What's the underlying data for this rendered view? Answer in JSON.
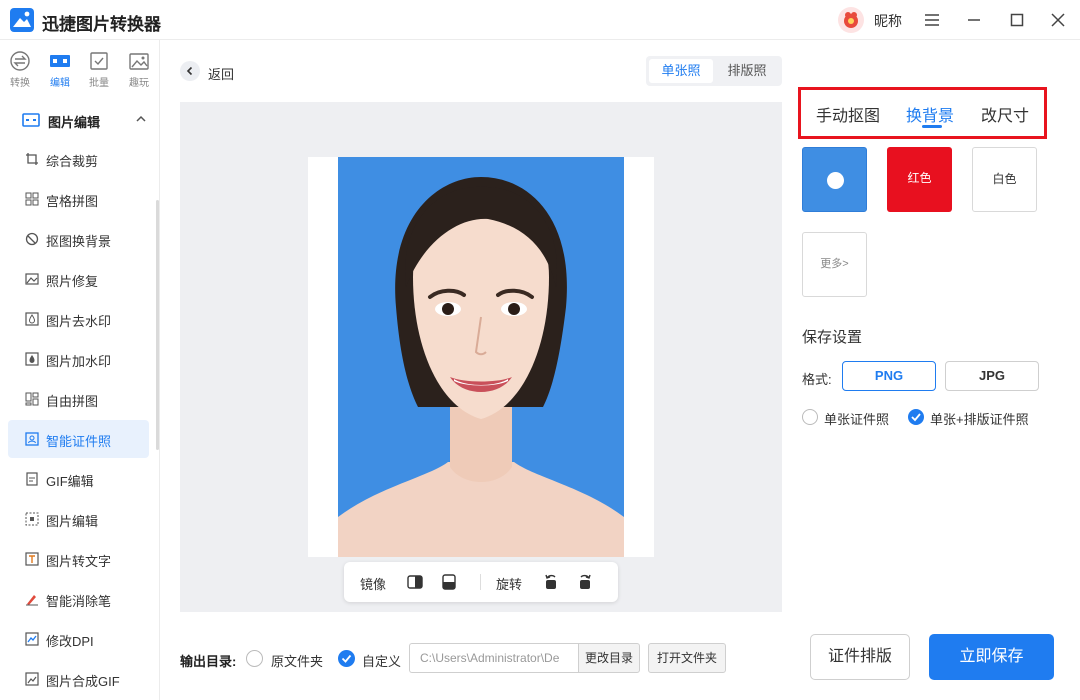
{
  "app": {
    "title": "迅捷图片转换器",
    "nickname": "昵称"
  },
  "mode_tabs": [
    {
      "label": "转换",
      "icon": "convert-icon"
    },
    {
      "label": "编辑",
      "icon": "edit-icon"
    },
    {
      "label": "批量",
      "icon": "batch-icon"
    },
    {
      "label": "趣玩",
      "icon": "fun-icon"
    }
  ],
  "sidebar": {
    "section_title": "图片编辑",
    "items": [
      {
        "label": "综合裁剪",
        "icon": "crop-icon"
      },
      {
        "label": "宫格拼图",
        "icon": "grid-icon"
      },
      {
        "label": "抠图换背景",
        "icon": "cutout-icon"
      },
      {
        "label": "照片修复",
        "icon": "repair-icon"
      },
      {
        "label": "图片去水印",
        "icon": "remove-watermark-icon"
      },
      {
        "label": "图片加水印",
        "icon": "add-watermark-icon"
      },
      {
        "label": "自由拼图",
        "icon": "collage-icon"
      },
      {
        "label": "智能证件照",
        "icon": "id-photo-icon",
        "active": true
      },
      {
        "label": "GIF编辑",
        "icon": "gif-icon"
      },
      {
        "label": "图片编辑",
        "icon": "image-edit-icon"
      },
      {
        "label": "图片转文字",
        "icon": "ocr-icon"
      },
      {
        "label": "智能消除笔",
        "icon": "eraser-pen-icon"
      },
      {
        "label": "修改DPI",
        "icon": "dpi-icon"
      },
      {
        "label": "图片合成GIF",
        "icon": "make-gif-icon"
      }
    ]
  },
  "main": {
    "back_label": "返回",
    "view_tabs": [
      "单张照",
      "排版照"
    ],
    "toolbar": {
      "mirror": "镜像",
      "rotate": "旋转"
    }
  },
  "right_panel": {
    "tabs": [
      "手动抠图",
      "换背景",
      "改尺寸"
    ],
    "active_tab": "换背景",
    "swatches": {
      "red": "红色",
      "white": "白色",
      "more": "更多>"
    },
    "selected_color": "#3f8ee3",
    "save_title": "保存设置",
    "format_label": "格式:",
    "formats": [
      "PNG",
      "JPG"
    ],
    "options": [
      "单张证件照",
      "单张+排版证件照"
    ]
  },
  "bottom": {
    "output_label": "输出目录:",
    "radio_original": "原文件夹",
    "radio_custom": "自定义",
    "path_value": "C:\\Users\\Administrator\\De",
    "change_dir": "更改目录",
    "open_folder": "打开文件夹",
    "layout_button": "证件排版",
    "save_button": "立即保存"
  },
  "colors": {
    "accent": "#1f7cf0",
    "red": "#e8101f",
    "photo_bg": "#3f8ee3"
  }
}
